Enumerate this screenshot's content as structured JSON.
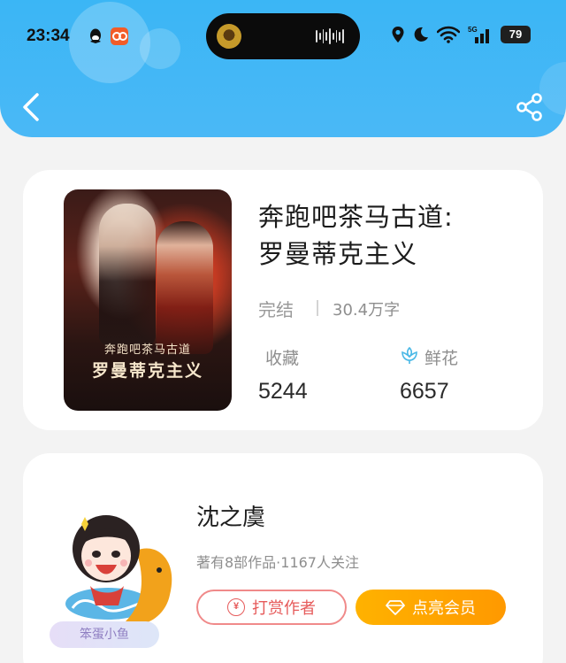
{
  "status_bar": {
    "time": "23:34",
    "battery": "79",
    "icons": [
      "qq-icon",
      "app-icon",
      "location-icon",
      "moon-icon",
      "wifi-icon",
      "5g-signal-icon",
      "battery-icon"
    ]
  },
  "nav": {
    "back_icon": "chevron-left-icon",
    "share_icon": "share-icon"
  },
  "book": {
    "title_line1": "奔跑吧茶马古道:",
    "title_line2": "罗曼蒂克主义",
    "status": "完结",
    "word_count": "30.4万字",
    "favorites_label": "收藏",
    "favorites_value": "5244",
    "flowers_label": "鲜花",
    "flowers_value": "6657",
    "cover": {
      "title_small": "奔跑吧茶马古道",
      "title_big": "罗曼蒂克主义"
    }
  },
  "author": {
    "name": "沈之虞",
    "meta": "著有8部作品·1167人关注",
    "tip_button": "打赏作者",
    "tip_icon_glyph": "¥",
    "vip_button": "点亮会员",
    "badge": "笨蛋小鱼"
  },
  "colors": {
    "header": "#3bb6f5",
    "tip_border": "#f08a8a",
    "vip": "#ff9900",
    "flower": "#49b8e6"
  }
}
